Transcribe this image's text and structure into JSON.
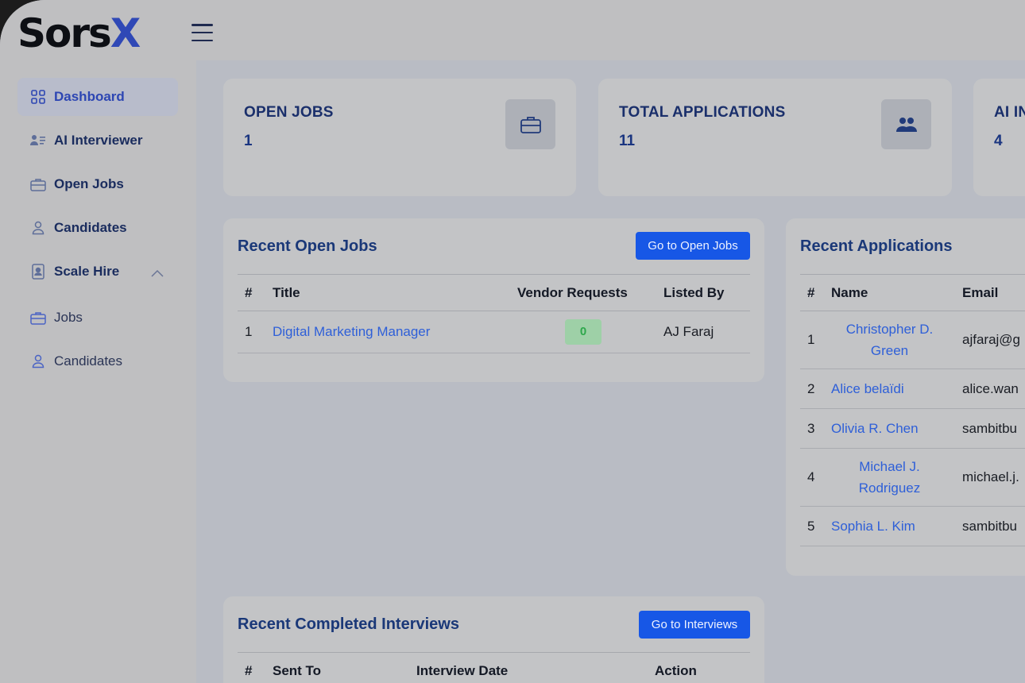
{
  "app": {
    "logo_main": "Sors",
    "logo_accent": "X"
  },
  "sidebar": {
    "items": [
      {
        "label": "Dashboard",
        "icon": "grid-icon"
      },
      {
        "label": "AI Interviewer",
        "icon": "user-list-icon"
      },
      {
        "label": "Open Jobs",
        "icon": "briefcase-icon"
      },
      {
        "label": "Candidates",
        "icon": "user-icon"
      },
      {
        "label": "Scale Hire",
        "icon": "badge-icon"
      },
      {
        "label": "Jobs",
        "icon": "briefcase-icon"
      },
      {
        "label": "Candidates",
        "icon": "user-icon"
      }
    ]
  },
  "stats": [
    {
      "label": "OPEN JOBS",
      "value": "1",
      "icon": "briefcase-icon"
    },
    {
      "label": "TOTAL APPLICATIONS",
      "value": "11",
      "icon": "users-icon"
    },
    {
      "label": "AI IN",
      "value": "4"
    }
  ],
  "recent_jobs": {
    "title": "Recent Open Jobs",
    "button": "Go to Open Jobs",
    "columns": [
      "#",
      "Title",
      "Vendor Requests",
      "Listed By"
    ],
    "rows": [
      {
        "num": "1",
        "title": "Digital Marketing Manager",
        "vendor_requests": "0",
        "listed_by": "AJ Faraj"
      }
    ]
  },
  "recent_applications": {
    "title": "Recent Applications",
    "columns": [
      "#",
      "Name",
      "Email"
    ],
    "rows": [
      {
        "num": "1",
        "name": "Christopher D. Green",
        "email": "ajfaraj@g"
      },
      {
        "num": "2",
        "name": "Alice belaïdi",
        "email": "alice.wan"
      },
      {
        "num": "3",
        "name": "Olivia R. Chen",
        "email": "sambitbu"
      },
      {
        "num": "4",
        "name": "Michael J. Rodriguez",
        "email": "michael.j."
      },
      {
        "num": "5",
        "name": "Sophia L. Kim",
        "email": "sambitbu"
      }
    ]
  },
  "recent_interviews": {
    "title": "Recent Completed Interviews",
    "button": "Go to Interviews",
    "columns": [
      "#",
      "Sent To",
      "Interview Date",
      "Action"
    ]
  }
}
